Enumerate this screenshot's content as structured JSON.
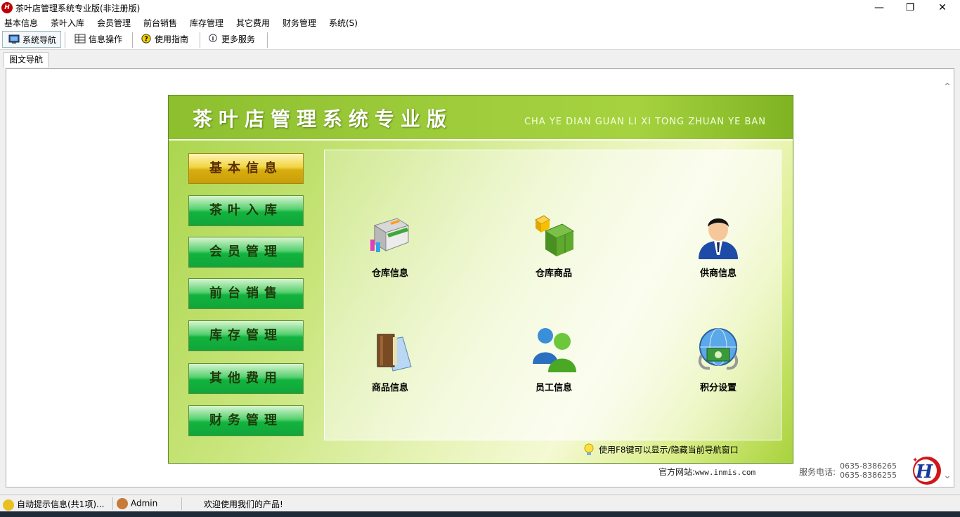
{
  "window": {
    "title": "茶叶店管理系统专业版(非注册版)",
    "controls": {
      "minimize": "—",
      "maximize": "❐",
      "close": "✕"
    }
  },
  "menu": [
    "基本信息",
    "茶叶入库",
    "会员管理",
    "前台销售",
    "库存管理",
    "其它费用",
    "财务管理",
    "系统(S)"
  ],
  "toolbar": {
    "items": [
      {
        "label": "系统导航",
        "icon": "monitor-icon",
        "active": true
      },
      {
        "label": "信息操作",
        "icon": "grid-icon",
        "active": false
      },
      {
        "label": "使用指南",
        "icon": "help-icon",
        "active": false
      },
      {
        "label": "更多服务",
        "icon": "info-icon",
        "active": false
      }
    ]
  },
  "tab": {
    "label": "图文导航"
  },
  "panel": {
    "title": "茶叶店管理系统专业版",
    "subtitle": "CHA YE DIAN GUAN LI XI TONG ZHUAN YE BAN",
    "nav": [
      "基本信息",
      "茶叶入库",
      "会员管理",
      "前台销售",
      "库存管理",
      "其他费用",
      "财务管理"
    ],
    "selected_nav": 0,
    "items": [
      {
        "label": "仓库信息",
        "icon": "warehouse-store-icon"
      },
      {
        "label": "仓库商品",
        "icon": "boxes-icon"
      },
      {
        "label": "供商信息",
        "icon": "person-icon"
      },
      {
        "label": "商品信息",
        "icon": "books-icon"
      },
      {
        "label": "员工信息",
        "icon": "users-icon"
      },
      {
        "label": "积分设置",
        "icon": "globe-money-icon"
      }
    ],
    "tip": "使用F8键可以显示/隐藏当前导航窗口"
  },
  "footer": {
    "official_label": "官方网站:",
    "official_url": "www.inmis.com",
    "service_label": "服务电话:",
    "phone1": "0635-8386265",
    "phone2": "0635-8386255"
  },
  "status": {
    "notice": "自动提示信息(共1项)...",
    "user": "Admin",
    "welcome": "欢迎使用我们的产品!"
  },
  "colors": {
    "nav_green": "#12b33e",
    "nav_selected": "#d8ad10",
    "banner": "#9ccb3a"
  }
}
